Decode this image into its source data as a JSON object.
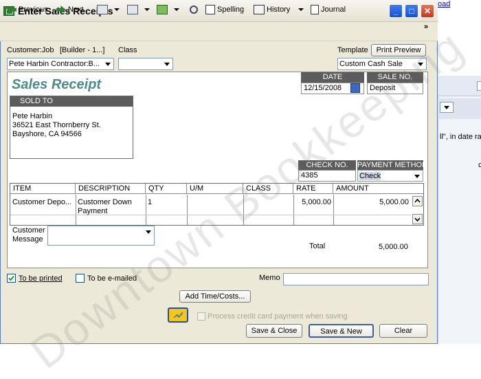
{
  "background_app": {
    "link_partial": "oad",
    "text_partial": "ll\", in date ra",
    "text_partial2": "c"
  },
  "window": {
    "title": "Enter Sales Receipts",
    "minimize_label": "_",
    "maximize_label": "□",
    "close_label": "✕"
  },
  "toolbar": {
    "previous": "Previous",
    "next": "Next",
    "spelling": "Spelling",
    "history": "History",
    "journal": "Journal",
    "more": "»"
  },
  "header": {
    "customer_job_label": "Customer:Job",
    "customer_job_value": "Pete Harbin Contractor:B...",
    "builder_label": "[Builder - 1...]",
    "class_label": "Class",
    "class_value": "",
    "template_label": "Template",
    "print_preview": "Print Preview",
    "template_value": "Custom Cash Sale"
  },
  "form": {
    "title": "Sales Receipt",
    "sold_to_label": "SOLD TO",
    "sold_to_lines": [
      "Pete Harbin",
      "36521 East Thornberry St.",
      "Bayshore, CA 94566"
    ],
    "date_label": "DATE",
    "date_value": "12/15/2008",
    "sale_no_label": "SALE NO.",
    "sale_no_value": "Deposit",
    "check_no_label": "CHECK NO.",
    "check_no_value": "4385",
    "payment_method_label": "PAYMENT METHOD",
    "payment_method_value": "Check"
  },
  "table": {
    "columns": [
      "ITEM",
      "DESCRIPTION",
      "QTY",
      "U/M",
      "CLASS",
      "RATE",
      "AMOUNT"
    ],
    "rows": [
      {
        "item": "Customer Depo...",
        "description_line1": "Customer Down",
        "description_line2": "Payment",
        "qty": "1",
        "um": "",
        "class": "",
        "rate": "5,000.00",
        "amount": "5,000.00"
      }
    ]
  },
  "footer": {
    "customer_message_label_1": "Customer",
    "customer_message_label_2": "Message",
    "total_label": "Total",
    "total_value": "5,000.00"
  },
  "bottom": {
    "to_be_printed": "To be printed",
    "to_be_printed_checked": true,
    "to_be_emailed": "To be e-mailed",
    "memo_label": "Memo",
    "memo_value": "",
    "add_time_costs": "Add Time/Costs...",
    "process_cc": "Process credit card payment when saving",
    "save_close": "Save & Close",
    "save_new": "Save & New",
    "clear": "Clear"
  },
  "watermark": "Downtown Bookkeeping"
}
